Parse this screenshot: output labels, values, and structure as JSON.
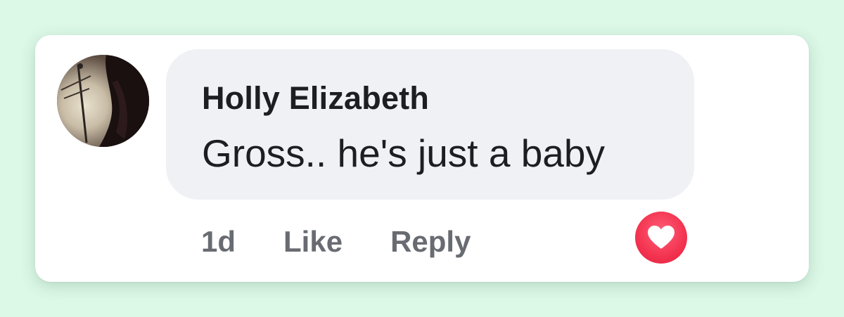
{
  "comment": {
    "author": "Holly Elizabeth",
    "text": "Gross.. he's just a baby",
    "avatar_alt": "profile-photo",
    "reaction_icon": "heart-icon",
    "reaction_color": "#f3334f"
  },
  "actions": {
    "time": "1d",
    "like_label": "Like",
    "reply_label": "Reply"
  },
  "colors": {
    "background": "#dcf8e7",
    "card": "#ffffff",
    "bubble": "#f0f1f5",
    "text": "#1c1e21",
    "muted": "#686c72"
  }
}
